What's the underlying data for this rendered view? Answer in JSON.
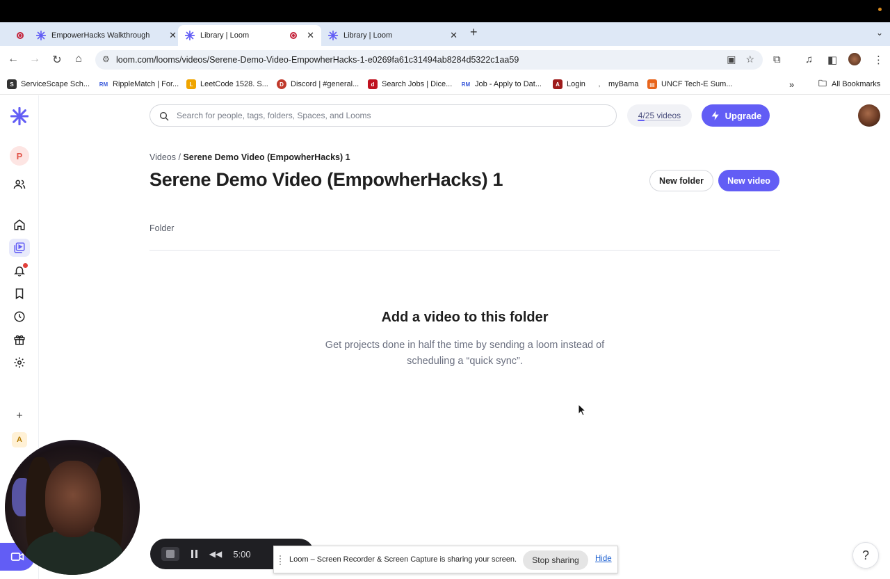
{
  "browser": {
    "tabs": [
      {
        "title": "EmpowerHacks Walkthrough",
        "active": false
      },
      {
        "title": "Library | Loom",
        "active": true
      },
      {
        "title": "Library | Loom",
        "active": false
      }
    ],
    "url": "loom.com/looms/videos/Serene-Demo-Video-EmpowherHacks-1-e0269fa61c31494ab8284d5322c1aa59",
    "bookmarks": [
      {
        "label": "ServiceScape Sch...",
        "color": "#333333"
      },
      {
        "label": "RippleMatch | For...",
        "color": "#3b5bdb"
      },
      {
        "label": "LeetCode 1528. S...",
        "color": "#f0a500"
      },
      {
        "label": "Discord | #general...",
        "color": "#c0392b"
      },
      {
        "label": "Search Jobs | Dice...",
        "color": "#c0121f"
      },
      {
        "label": "Job - Apply to Dat...",
        "color": "#3b5bdb"
      },
      {
        "label": "Login",
        "color": "#9e1b1b"
      },
      {
        "label": "myBama",
        "color": "#ffffff"
      },
      {
        "label": "UNCF Tech-E Sum...",
        "color": "#e8651c"
      }
    ],
    "all_bookmarks": "All Bookmarks"
  },
  "sidebar": {
    "workspace_initial": "P",
    "bottom_initial": "A",
    "add_label": "+"
  },
  "header": {
    "search_placeholder": "Search for people, tags, folders, Spaces, and Looms",
    "quota": "4/25 videos",
    "quota_fraction": 0.16,
    "upgrade_label": "Upgrade"
  },
  "page": {
    "breadcrumb_root": "Videos",
    "breadcrumb_sep": "/",
    "breadcrumb_current": "Serene Demo Video (EmpowherHacks) 1",
    "title": "Serene Demo Video (EmpowherHacks) 1",
    "new_folder": "New folder",
    "new_video": "New video",
    "folder_label": "Folder",
    "empty_title": "Add a video to this folder",
    "empty_text": "Get projects done in half the time by sending a loom instead of scheduling a “quick sync”."
  },
  "recorder": {
    "time": "5:00"
  },
  "share_bar": {
    "message": "Loom – Screen Recorder & Screen Capture is sharing your screen.",
    "stop_label": "Stop sharing",
    "hide_label": "Hide"
  },
  "help_label": "?",
  "colors": {
    "accent": "#625df5",
    "recording_red": "#c4243c"
  }
}
